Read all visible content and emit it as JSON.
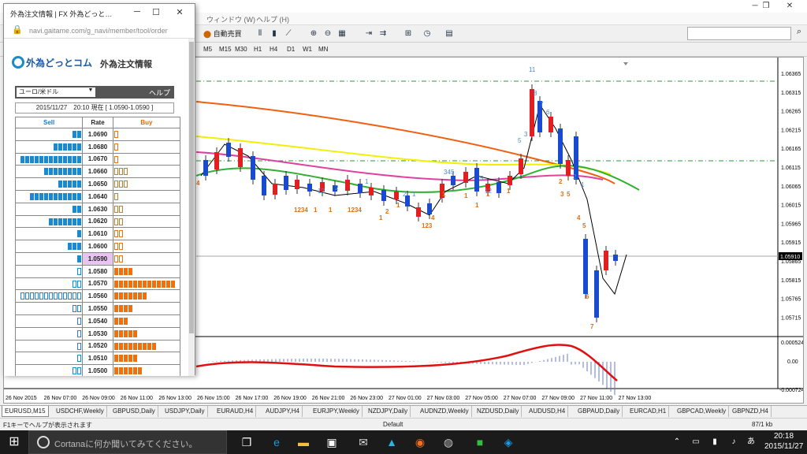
{
  "menubar": {
    "window_menu": "ウィンドウ (W)",
    "help_menu": "ヘルプ (H)"
  },
  "toolbar": {
    "autotrade_label": "自動売買"
  },
  "timeframes": [
    "M5",
    "M15",
    "M30",
    "H1",
    "H4",
    "D1",
    "W1",
    "MN"
  ],
  "chart": {
    "price_labels": [
      "1.06365",
      "1.06315",
      "1.06265",
      "1.06215",
      "1.06165",
      "1.06115",
      "1.06065",
      "1.06015",
      "1.05965",
      "1.05915",
      "1.05865",
      "1.05815",
      "1.05765",
      "1.05715"
    ],
    "current_price": "1.05910",
    "macd_labels": [
      "0.000524",
      "0.00",
      "-0.000724"
    ],
    "time_labels": [
      "26 Nov 2015",
      "26 Nov 07:00",
      "26 Nov 09:00",
      "26 Nov 11:00",
      "26 Nov 13:00",
      "26 Nov 15:00",
      "26 Nov 17:00",
      "26 Nov 19:00",
      "26 Nov 21:00",
      "26 Nov 23:00",
      "27 Nov 01:00",
      "27 Nov 03:00",
      "27 Nov 05:00",
      "27 Nov 07:00",
      "27 Nov 09:00",
      "27 Nov 11:00",
      "27 Nov 13:00"
    ],
    "td_labels_orange": [
      "4",
      "1234",
      "1",
      "1",
      "1234",
      "1",
      "2",
      "1",
      "123",
      "4",
      "1",
      "1",
      "1",
      "1",
      "1",
      "2",
      "3",
      "5",
      "4",
      "5",
      "6",
      "7"
    ],
    "td_labels_blue": [
      "11",
      "8",
      "7",
      "6",
      "5",
      "3",
      "12",
      "2",
      "1",
      "2",
      "1",
      "345",
      "5",
      "12",
      "2",
      "1"
    ]
  },
  "tabs": [
    "EURUSD,M15",
    "USDCHF,Weekly",
    "GBPUSD,Daily",
    "USDJPY,Daily",
    "EURAUD,H4",
    "AUDJPY,H4",
    "EURJPY,Weekly",
    "NZDJPY,Daily",
    "AUDNZD,Weekly",
    "NZDUSD,Daily",
    "AUDUSD,H4",
    "GBPAUD,Daily",
    "EURCAD,H1",
    "GBPCAD,Weekly",
    "GBPNZD,H4"
  ],
  "status": {
    "help_hint": "F1キーでヘルプが表示されます",
    "profile": "Default",
    "traffic": "87/1 kb"
  },
  "taskbar": {
    "cortana_placeholder": "Cortanaに何か聞いてみてください。",
    "time": "20:18",
    "date": "2015/11/27"
  },
  "popup": {
    "title": "外為注文情報 | FX 外為どっと…",
    "url": "navi.gaitame.com/g_navi/member/tool/order",
    "brand": "外為どっとコム",
    "brand_sub": "外為注文情報",
    "pair": "ユーロ/米ドル",
    "help": "ヘルプ",
    "quote": "2015/11/27　20:10 現在 [ 1.0590-1.0590 ]",
    "headers": {
      "sell": "Sell",
      "rate": "Rate",
      "buy": "Buy"
    },
    "rows": [
      {
        "rate": "1.0690",
        "sell": 2,
        "sell_o": 0,
        "buy": 0,
        "buy_o": 1
      },
      {
        "rate": "1.0680",
        "sell": 6,
        "sell_o": 0,
        "buy": 0,
        "buy_o": 1
      },
      {
        "rate": "1.0670",
        "sell": 13,
        "sell_o": 0,
        "buy": 0,
        "buy_o": 1
      },
      {
        "rate": "1.0660",
        "sell": 8,
        "sell_o": 0,
        "buy": 0,
        "buy_o": 3
      },
      {
        "rate": "1.0650",
        "sell": 5,
        "sell_o": 0,
        "buy": 0,
        "buy_o": 3
      },
      {
        "rate": "1.0640",
        "sell": 11,
        "sell_o": 0,
        "buy": 0,
        "buy_o": 1
      },
      {
        "rate": "1.0630",
        "sell": 2,
        "sell_o": 0,
        "buy": 0,
        "buy_o": 2
      },
      {
        "rate": "1.0620",
        "sell": 7,
        "sell_o": 0,
        "buy": 0,
        "buy_o": 2
      },
      {
        "rate": "1.0610",
        "sell": 1,
        "sell_o": 0,
        "buy": 0,
        "buy_o": 2
      },
      {
        "rate": "1.0600",
        "sell": 3,
        "sell_o": 0,
        "buy": 0,
        "buy_o": 2
      },
      {
        "rate": "1.0590",
        "sell": 1,
        "sell_o": 0,
        "buy": 0,
        "buy_o": 2,
        "current": true
      },
      {
        "rate": "1.0580",
        "sell": 0,
        "sell_o": 1,
        "buy": 4,
        "buy_o": 0
      },
      {
        "rate": "1.0570",
        "sell": 0,
        "sell_o": 2,
        "buy": 13,
        "buy_o": 0
      },
      {
        "rate": "1.0560",
        "sell": 0,
        "sell_o": 13,
        "buy": 7,
        "buy_o": 0
      },
      {
        "rate": "1.0550",
        "sell": 0,
        "sell_o": 2,
        "buy": 4,
        "buy_o": 0
      },
      {
        "rate": "1.0540",
        "sell": 0,
        "sell_o": 1,
        "buy": 3,
        "buy_o": 0
      },
      {
        "rate": "1.0530",
        "sell": 0,
        "sell_o": 1,
        "buy": 5,
        "buy_o": 0
      },
      {
        "rate": "1.0520",
        "sell": 0,
        "sell_o": 1,
        "buy": 9,
        "buy_o": 0
      },
      {
        "rate": "1.0510",
        "sell": 0,
        "sell_o": 1,
        "buy": 5,
        "buy_o": 0
      },
      {
        "rate": "1.0500",
        "sell": 0,
        "sell_o": 2,
        "buy": 6,
        "buy_o": 0
      }
    ]
  }
}
